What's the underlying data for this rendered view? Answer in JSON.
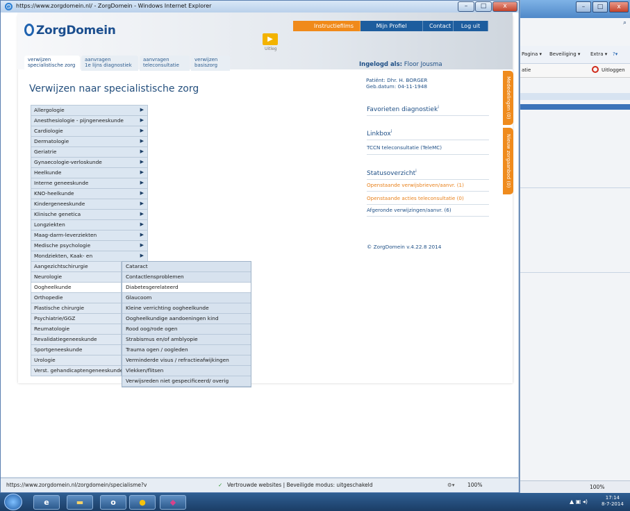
{
  "window": {
    "title": "https://www.zorgdomein.nl/ - ZorgDomein - Windows Internet Explorer",
    "min": "–",
    "max": "□",
    "close": "x"
  },
  "bg_window": {
    "search_icon": "⌕",
    "cmd_pagina": "Pagina ▾",
    "cmd_beveiliging": "Beveiliging ▾",
    "cmd_extra": "Extra ▾",
    "cmd_help": "?▾",
    "fav_partial": "atie",
    "uitloggen": "Uitloggen",
    "status_zoom": "100%"
  },
  "brand": {
    "name": "ZorgDomein",
    "accent": "#1f63b0",
    "orange": "#f08a1a"
  },
  "topnav": [
    "Instructiefilms",
    "Mijn Profiel",
    "Contact",
    "Log uit"
  ],
  "tabs": [
    {
      "line1": "verwijzen",
      "line2": "specialistische zorg",
      "active": true
    },
    {
      "line1": "aanvragen",
      "line2": "1e lijns diagnostiek",
      "active": false
    },
    {
      "line1": "aanvragen",
      "line2": "teleconsultatie",
      "active": false
    },
    {
      "line1": "verwijzen",
      "line2": "basiszorg",
      "active": false
    }
  ],
  "uitleg": "Uitleg",
  "logged_in": {
    "label": "Ingelogd als:",
    "name": "Floor Jousma"
  },
  "page_title": "Verwijzen naar specialistische zorg",
  "specialties": [
    "Allergologie",
    "Anesthesiologie - pijngeneeskunde",
    "Cardiologie",
    "Dermatologie",
    "Geriatrie",
    "Gynaecologie-verloskunde",
    "Heelkunde",
    "Interne geneeskunde",
    "KNO-heelkunde",
    "Kindergeneeskunde",
    "Klinische genetica",
    "Longziekten",
    "Maag-darm-leverziekten",
    "Medische psychologie",
    "Mondziekten, Kaak- en",
    "Aangezichtschirurgie",
    "Neurologie",
    "Oogheelkunde",
    "Orthopedie",
    "Plastische chirurgie",
    "Psychiatrie/GGZ",
    "Reumatologie",
    "Revalidatiegeneeskunde",
    "Sportgeneeskunde",
    "Urologie",
    "Verst. gehandicaptengeneeskunde"
  ],
  "submenu": [
    "Cataract",
    "Contactlensproblemen",
    "Diabetesgerelateerd",
    "Glaucoom",
    "Kleine verrichting oogheelkunde",
    "Oogheelkundige aandoeningen kind",
    "Rood oog/rode ogen",
    "Strabismus en/of amblyopie",
    "Trauma ogen / oogleden",
    "Verminderde visus / refractieafwijkingen",
    "Vlekken/flitsen",
    "Verwijsreden niet gespecificeerd/ overig"
  ],
  "patient": {
    "line1": "Patiënt: Dhr. H. BORGER",
    "line2": "Geb.datum: 04-11-1948"
  },
  "favorieten": "Favorieten diagnostiek",
  "linkbox": "Linkbox",
  "linkbox_item": "TCCN teleconsultatie (TeleMC)",
  "status_title": "Statusoverzicht",
  "status_items": [
    "Openstaande verwijsbrieven/aanvr. (1)",
    "Openstaande acties teleconsultatie (0)",
    "Afgeronde verwijzingen/aanvr. (6)"
  ],
  "info_mark": "i",
  "copyright": "© ZorgDomein v.4.22.8 2014",
  "side_tabs": [
    "Mededelingen (0)",
    "Nieuw zorgaanbod (0)"
  ],
  "statusbar": {
    "url": "https://www.zorgdomein.nl/zorgdomein/specialisme?v",
    "zone": "Vertrouwde websites | Beveiligde modus: uitgeschakeld",
    "zoom": "100%"
  },
  "clock": {
    "time": "17:14",
    "date": "8-7-2014"
  }
}
